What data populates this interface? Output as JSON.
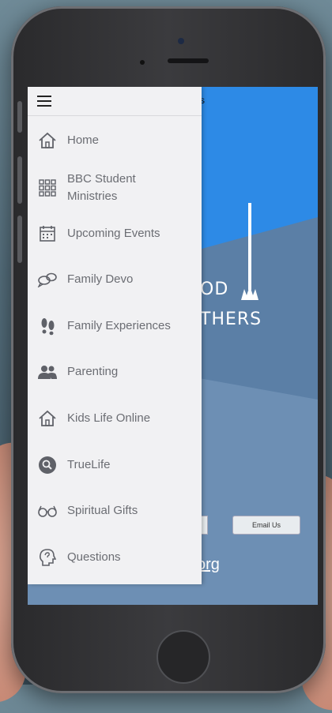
{
  "app": {
    "tab_title_fragment": "s",
    "email_button": "Email Us",
    "url_fragment": "org",
    "logo_line1": "OD",
    "logo_line2": "THERS"
  },
  "drawer": {
    "menu_icon": "hamburger-icon",
    "items": [
      {
        "label": "Home",
        "icon": "home-icon"
      },
      {
        "label": "BBC Student\nMinistries",
        "icon": "grid-icon"
      },
      {
        "label": "Upcoming Events",
        "icon": "calendar-icon"
      },
      {
        "label": "Family Devo",
        "icon": "chat-bubbles-icon"
      },
      {
        "label": "Family Experiences",
        "icon": "footprints-icon"
      },
      {
        "label": "Parenting",
        "icon": "people-icon"
      },
      {
        "label": "Kids Life Online",
        "icon": "house-icon"
      },
      {
        "label": "TrueLife",
        "icon": "search-circle-icon"
      },
      {
        "label": "Spiritual Gifts",
        "icon": "glasses-icon"
      },
      {
        "label": "Questions",
        "icon": "head-icon"
      }
    ]
  },
  "colors": {
    "drawer_bg": "#f1f1f3",
    "header_blue": "#2d8ae6",
    "menu_text": "#6b6d73"
  }
}
